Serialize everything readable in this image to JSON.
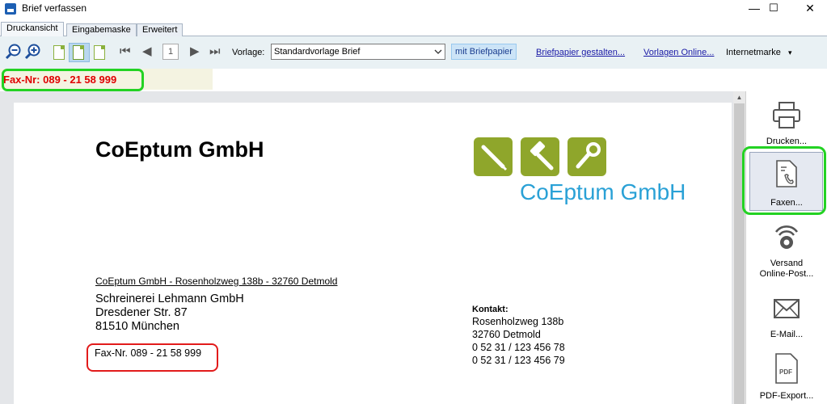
{
  "window": {
    "title": "Brief verfassen",
    "minimize": "—",
    "maximize": "☐",
    "close": "✕"
  },
  "tabs": [
    "Druckansicht",
    "Eingabemaske",
    "Erweitert"
  ],
  "toolbar": {
    "page_number": "1",
    "vorlage_label": "Vorlage:",
    "vorlage_value": "Standardvorlage Brief",
    "mit_briefpapier": "mit Briefpapier",
    "briefpapier_gestalten": "Briefpapier gestalten...",
    "vorlagen_online": "Vorlagen Online...",
    "internetmarke": "Internetmarke",
    "internetmarke_arrow": "▾"
  },
  "fax_header": "Fax-Nr:  089 - 21 58 999",
  "letter": {
    "company_heading": "CoEptum GmbH",
    "logo_text": "CoEptum GmbH",
    "sender_line": "CoEptum GmbH - Rosenholzweg 138b - 32760 Detmold",
    "recipient": [
      "Schreinerei Lehmann GmbH",
      "Dresdener Str. 87",
      "81510 München"
    ],
    "fax_inline": "Fax-Nr. 089 - 21 58 999",
    "kontakt_label": "Kontakt:",
    "kontakt_lines": [
      "Rosenholzweg 138b",
      "32760 Detmold",
      "0 52 31 / 123 456 78",
      "0 52 31 / 123 456 79"
    ]
  },
  "sidebar": {
    "drucken": "Drucken...",
    "faxen": "Faxen...",
    "versand_line1": "Versand",
    "versand_line2": "Online-Post...",
    "email": "E-Mail...",
    "pdf_export": "PDF-Export...",
    "pdf_badge": "PDF"
  },
  "colors": {
    "highlight_green": "#23d223",
    "highlight_red": "#e21b1b",
    "logo_green": "#8fa62b",
    "logo_blue": "#2aa1d6",
    "fax_red": "#e00000"
  }
}
